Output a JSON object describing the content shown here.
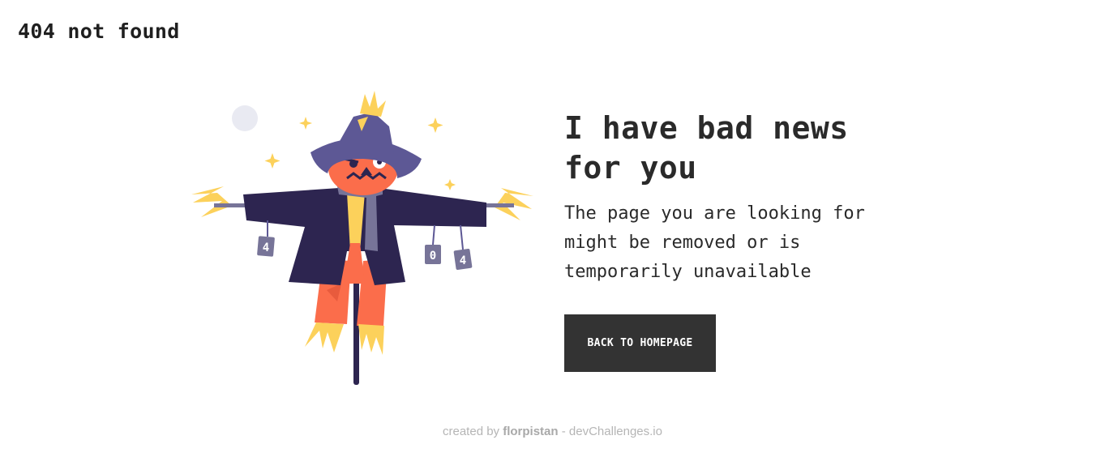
{
  "brand": {
    "title": "404 not found"
  },
  "hero": {
    "headline": "I have bad news for you",
    "message": "The page you are looking for might be removed or is temporarily unavailable",
    "cta_label": "BACK TO HOMEPAGE"
  },
  "illustration": {
    "cans": [
      "4",
      "0",
      "4"
    ],
    "colors": {
      "hat": "#5d5895",
      "coat": "#2d2550",
      "body": "#fb6d4b",
      "straw": "#fcd15b",
      "moon": "#e9eaf2"
    }
  },
  "footer": {
    "prefix": "created by",
    "author": "florpistan",
    "separator": "-",
    "site": "devChallenges.io"
  }
}
